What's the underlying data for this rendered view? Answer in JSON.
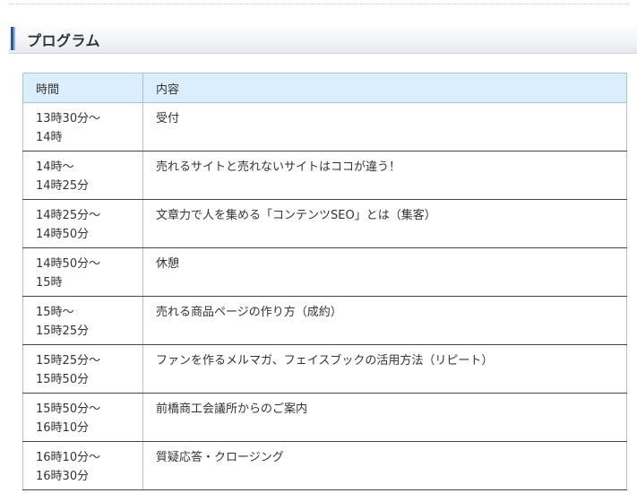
{
  "section": {
    "title": "プログラム"
  },
  "table": {
    "headers": {
      "time": "時間",
      "content": "内容"
    },
    "rows": [
      {
        "time_start": "13時30分～",
        "time_end": "14時",
        "content": "受付"
      },
      {
        "time_start": "14時～",
        "time_end": "14時25分",
        "content": "売れるサイトと売れないサイトはココが違う！"
      },
      {
        "time_start": "14時25分～",
        "time_end": "14時50分",
        "content": "文章力で人を集める「コンテンツSEO」とは（集客）"
      },
      {
        "time_start": "14時50分～",
        "time_end": "15時",
        "content": "休憩"
      },
      {
        "time_start": "15時～",
        "time_end": "15時25分",
        "content": "売れる商品ページの作り方（成約）"
      },
      {
        "time_start": "15時25分～",
        "time_end": "15時50分",
        "content": "ファンを作るメルマガ、フェイスブックの活用方法（リピート）"
      },
      {
        "time_start": "15時50分～",
        "time_end": "16時10分",
        "content": "前橋商工会議所からのご案内"
      },
      {
        "time_start": "16時10分～",
        "time_end": "16時30分",
        "content": "質疑応答・クロージング"
      }
    ]
  },
  "colors": {
    "header_bg": "#dbeefd",
    "header_border": "#9fc4e6",
    "accent_marker": "#2b5b8c"
  }
}
